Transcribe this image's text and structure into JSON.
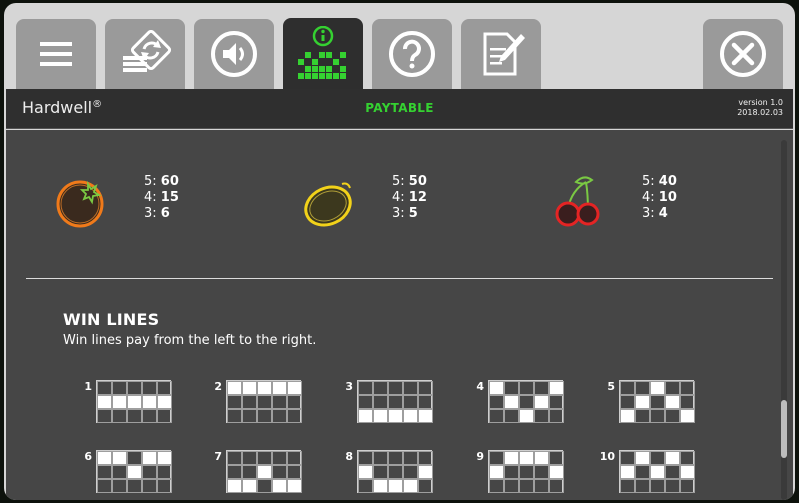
{
  "header": {
    "brand": "Hardwell",
    "brand_mark": "®",
    "section_title": "PAYTABLE",
    "version": "version 1.0",
    "date": "2018.02.03"
  },
  "tabs": [
    {
      "icon": "menu-icon",
      "active": false
    },
    {
      "icon": "autoplay-icon",
      "active": false
    },
    {
      "icon": "sound-icon",
      "active": false
    },
    {
      "icon": "paytable-icon",
      "active": true
    },
    {
      "icon": "help-icon",
      "active": false
    },
    {
      "icon": "notes-icon",
      "active": false
    },
    {
      "icon": "close-icon",
      "active": false
    }
  ],
  "symbols": [
    {
      "name": "orange",
      "color": "#f07a1a",
      "pays": [
        {
          "count": "5:",
          "value": "60"
        },
        {
          "count": "4:",
          "value": "15"
        },
        {
          "count": "3:",
          "value": "6"
        }
      ]
    },
    {
      "name": "lemon",
      "color": "#f2d21a",
      "pays": [
        {
          "count": "5:",
          "value": "50"
        },
        {
          "count": "4:",
          "value": "12"
        },
        {
          "count": "3:",
          "value": "5"
        }
      ]
    },
    {
      "name": "cherry",
      "color": "#e42424",
      "pays": [
        {
          "count": "5:",
          "value": "40"
        },
        {
          "count": "4:",
          "value": "10"
        },
        {
          "count": "3:",
          "value": "4"
        }
      ]
    }
  ],
  "win_lines": {
    "title": "WIN LINES",
    "description": "Win lines pay from the left to the right.",
    "lines": [
      {
        "number": "1",
        "rows": [
          1,
          1,
          1,
          1,
          1
        ]
      },
      {
        "number": "2",
        "rows": [
          0,
          0,
          0,
          0,
          0
        ]
      },
      {
        "number": "3",
        "rows": [
          2,
          2,
          2,
          2,
          2
        ]
      },
      {
        "number": "4",
        "rows": [
          0,
          1,
          2,
          1,
          0
        ]
      },
      {
        "number": "5",
        "rows": [
          2,
          1,
          0,
          1,
          2
        ]
      },
      {
        "number": "6",
        "rows": [
          0,
          0,
          1,
          0,
          0
        ]
      },
      {
        "number": "7",
        "rows": [
          2,
          2,
          1,
          2,
          2
        ]
      },
      {
        "number": "8",
        "rows": [
          1,
          2,
          2,
          2,
          1
        ]
      },
      {
        "number": "9",
        "rows": [
          1,
          0,
          0,
          0,
          1
        ]
      },
      {
        "number": "10",
        "rows": [
          1,
          0,
          1,
          0,
          1
        ]
      }
    ]
  },
  "colors": {
    "accent": "#35d131",
    "panel": "#464646",
    "tab": "#9a9a9a",
    "tab_active": "#2e2e2e"
  }
}
